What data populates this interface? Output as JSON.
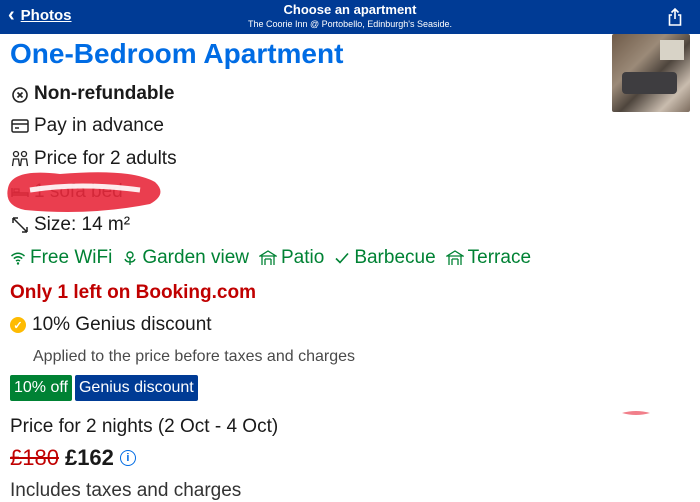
{
  "nav": {
    "back_label": "Photos",
    "title": "Choose an apartment",
    "subtitle": "The Coorie Inn @ Portobello, Edinburgh's Seaside."
  },
  "room": {
    "name": "One-Bedroom Apartment",
    "features": [
      {
        "icon": "non-refundable-icon",
        "label": "Non-refundable"
      },
      {
        "icon": "payment-card-icon",
        "label": "Pay in advance"
      },
      {
        "icon": "adults-icon",
        "label": "Price for 2 adults"
      },
      {
        "icon": "bed-icon",
        "label": "1 sofa bed"
      },
      {
        "icon": "size-icon",
        "label": "Size: 14 m²"
      }
    ],
    "facilities": [
      {
        "icon": "wifi-icon",
        "label": "Free WiFi"
      },
      {
        "icon": "garden-icon",
        "label": "Garden view"
      },
      {
        "icon": "patio-icon",
        "label": "Patio"
      },
      {
        "icon": "check-icon",
        "label": "Barbecue"
      },
      {
        "icon": "terrace-icon",
        "label": "Terrace"
      }
    ],
    "availability": "Only 1 left on Booking.com",
    "genius": {
      "title": "10% Genius discount",
      "description": "Applied to the price before taxes and charges",
      "badge_off": "10% off",
      "badge_genius": "Genius discount"
    },
    "price": {
      "nights_label": "Price for 2 nights (2 Oct - 4 Oct)",
      "original": "£180",
      "current": "£162",
      "taxes_note": "Includes taxes and charges"
    }
  },
  "colors": {
    "brand_blue": "#003b95",
    "heading_blue": "#006ce4",
    "green": "#008234",
    "red": "#c00000",
    "genius_gold": "#febb02",
    "scribble_red": "#e8293c"
  }
}
